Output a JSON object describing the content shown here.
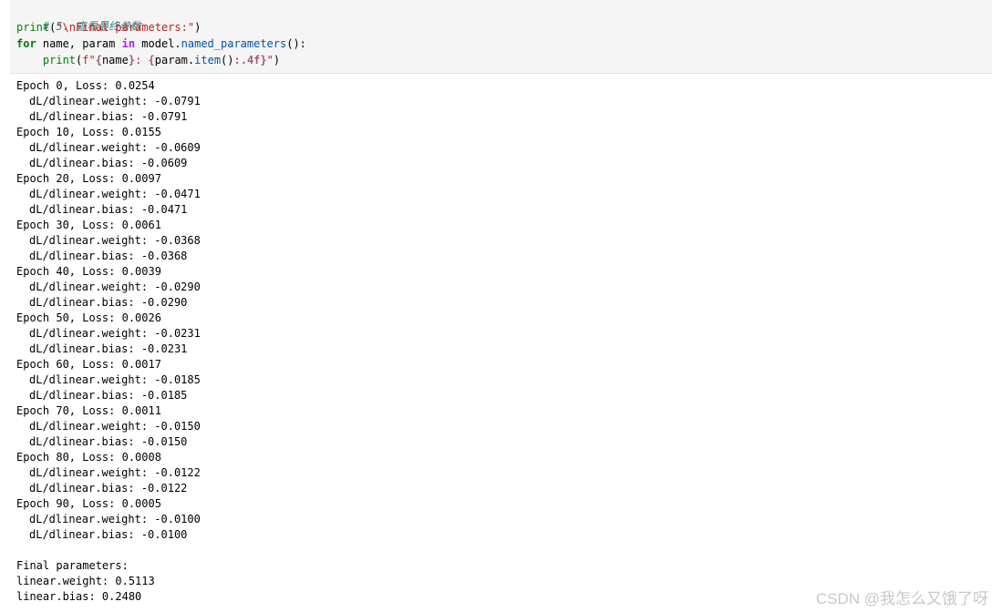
{
  "code": {
    "comment": "# 5. 查看最终参数",
    "line2": {
      "fn": "print",
      "open": "(",
      "str": "\"\\nFinal parameters:\"",
      "close": ")"
    },
    "line3": {
      "kw_for": "for",
      "vars": " name, param ",
      "kw_in": "in",
      "obj": " model.",
      "method": "named_parameters",
      "end": "():"
    },
    "line4": {
      "indent": "    ",
      "fn": "print",
      "open": "(",
      "fstr_start": "f\"",
      "b1": "{",
      "v1": "name",
      "b1c": "}",
      "sep": ": ",
      "b2": "{",
      "v2": "param.",
      "m2": "item",
      "call": "()",
      "fmt": ":.4f",
      "b2c": "}",
      "fstr_end": "\"",
      "close": ")"
    }
  },
  "output": {
    "epochs": [
      {
        "epoch_line": "Epoch 0, Loss: 0.0254",
        "weight_line": "dL/dlinear.weight: -0.0791",
        "bias_line": "dL/dlinear.bias: -0.0791"
      },
      {
        "epoch_line": "Epoch 10, Loss: 0.0155",
        "weight_line": "dL/dlinear.weight: -0.0609",
        "bias_line": "dL/dlinear.bias: -0.0609"
      },
      {
        "epoch_line": "Epoch 20, Loss: 0.0097",
        "weight_line": "dL/dlinear.weight: -0.0471",
        "bias_line": "dL/dlinear.bias: -0.0471"
      },
      {
        "epoch_line": "Epoch 30, Loss: 0.0061",
        "weight_line": "dL/dlinear.weight: -0.0368",
        "bias_line": "dL/dlinear.bias: -0.0368"
      },
      {
        "epoch_line": "Epoch 40, Loss: 0.0039",
        "weight_line": "dL/dlinear.weight: -0.0290",
        "bias_line": "dL/dlinear.bias: -0.0290"
      },
      {
        "epoch_line": "Epoch 50, Loss: 0.0026",
        "weight_line": "dL/dlinear.weight: -0.0231",
        "bias_line": "dL/dlinear.bias: -0.0231"
      },
      {
        "epoch_line": "Epoch 60, Loss: 0.0017",
        "weight_line": "dL/dlinear.weight: -0.0185",
        "bias_line": "dL/dlinear.bias: -0.0185"
      },
      {
        "epoch_line": "Epoch 70, Loss: 0.0011",
        "weight_line": "dL/dlinear.weight: -0.0150",
        "bias_line": "dL/dlinear.bias: -0.0150"
      },
      {
        "epoch_line": "Epoch 80, Loss: 0.0008",
        "weight_line": "dL/dlinear.weight: -0.0122",
        "bias_line": "dL/dlinear.bias: -0.0122"
      },
      {
        "epoch_line": "Epoch 90, Loss: 0.0005",
        "weight_line": "dL/dlinear.weight: -0.0100",
        "bias_line": "dL/dlinear.bias: -0.0100"
      }
    ],
    "final_header": "Final parameters:",
    "final_weight": "linear.weight: 0.5113",
    "final_bias": "linear.bias: 0.2480"
  },
  "watermark": "CSDN @我怎么又饿了呀"
}
